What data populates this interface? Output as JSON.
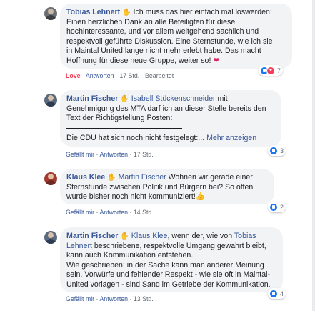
{
  "colors": {
    "link": "#385898",
    "bubble": "#f2f3f5",
    "like": "#1877f2",
    "love": "#f33e58",
    "meta": "#606770"
  },
  "comments": [
    {
      "author": "Tobias Lehnert",
      "text_lines": [
        " Ich muss das hier einfach mal loswerden:",
        "Einen herzlichen Dank an alle Beteiligten für diese",
        "hochinteressante, und vor allem weitgehend sachlich und",
        "respektvoll geführte Diskussion. Eine Sternstunde, wie ich sie",
        "in Maintal United lange nicht mehr erlebt habe. Das macht",
        "Hoffnung für diese neue Gruppe, weiter so! "
      ],
      "emoji": "heart-emoji",
      "actions": {
        "reaction": "Love",
        "reply": "Antworten",
        "time": "17 Std.",
        "edited": "Bearbeitet"
      },
      "reactions": {
        "types": [
          "like",
          "love"
        ],
        "count": "7"
      }
    },
    {
      "author": "Martin Fischer",
      "mention": "Isabell Stückenschneider",
      "text_lines": [
        " mit",
        "Genehmigung des MTA darf ich an dieser Stelle bereits den",
        "Text der Richtigstellung Posten:",
        "Die CDU hat sich noch nicht festgelegt:... "
      ],
      "more_link": "Mehr anzeigen",
      "actions": {
        "reaction": "Gefällt mir",
        "reply": "Antworten",
        "time": "17 Std."
      },
      "reactions": {
        "types": [
          "like"
        ],
        "count": "3"
      }
    },
    {
      "author": "Klaus Klee",
      "mention": "Martin Fischer",
      "text_lines": [
        " Wohnen wir gerade einer",
        "Sternstunde zwischen Politik und Bürgern bei? So offen",
        "wurde bisher noch nicht kommuniziert!"
      ],
      "emoji": "thumbs-up-emoji",
      "actions": {
        "reaction": "Gefällt mir",
        "reply": "Antworten",
        "time": "14 Std."
      },
      "reactions": {
        "types": [
          "like"
        ],
        "count": "2"
      }
    },
    {
      "author": "Martin Fischer",
      "mention": "Klaus Klee",
      "mention2": "Tobias",
      "mention3": "Lehnert",
      "text_lines": [
        ", wenn der, wie von ",
        " beschriebene, respektvolle Umgang gewahrt bleibt,",
        "kann auch Kommunikation entstehen.",
        "Wie geschrieben: in der Sache kann man anderer Meinung",
        "sein. Vorwürfe und fehlender Respekt - wie sie oft in Maintal-",
        "United vorlagen - sind Sand im Getriebe der Kommunikation."
      ],
      "actions": {
        "reaction": "Gefällt mir",
        "reply": "Antworten",
        "time": "13 Std."
      },
      "reactions": {
        "types": [
          "like"
        ],
        "count": "4"
      }
    }
  ]
}
